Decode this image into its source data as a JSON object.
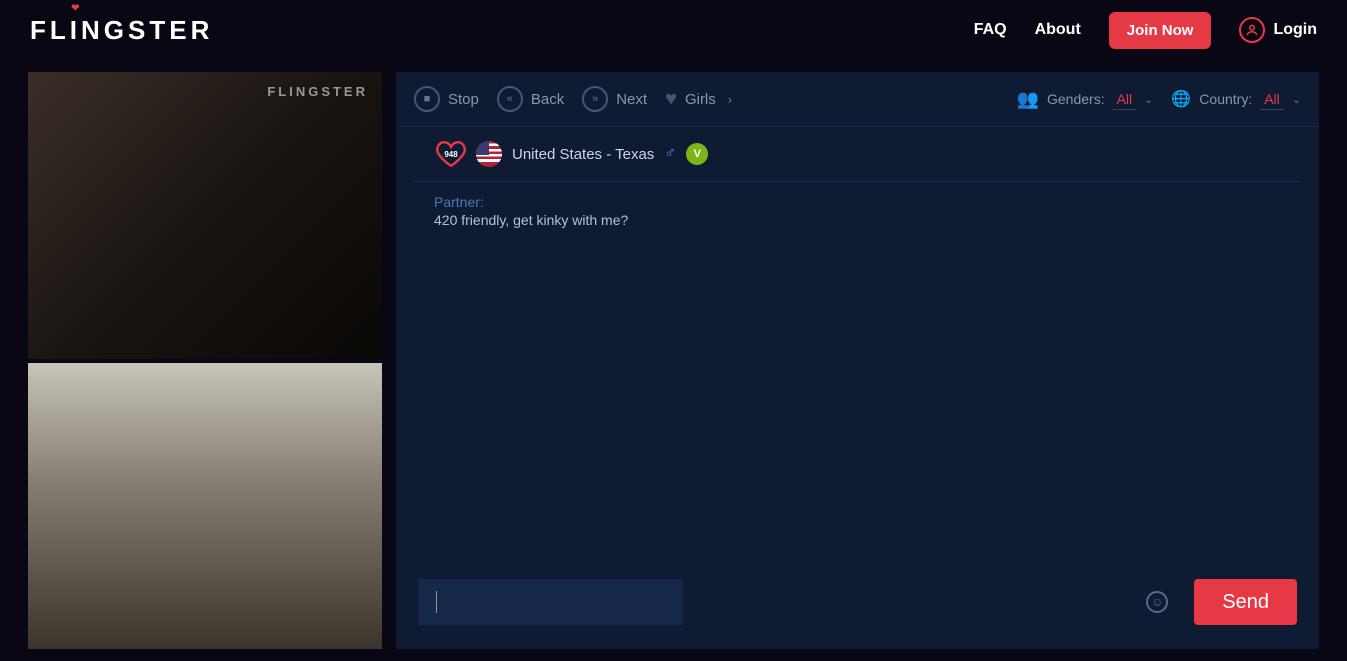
{
  "brand": "FLINGSTER",
  "watermark": "FLINGSTER",
  "nav": {
    "faq": "FAQ",
    "about": "About",
    "join": "Join Now",
    "login": "Login"
  },
  "toolbar": {
    "stop": "Stop",
    "back": "Back",
    "next": "Next",
    "girls": "Girls",
    "genders_label": "Genders:",
    "genders_value": "All",
    "country_label": "Country:",
    "country_value": "All"
  },
  "partner": {
    "likes": "948",
    "location": "United States - Texas",
    "verified_letter": "V"
  },
  "messages": {
    "label": "Partner:",
    "text": "420 friendly, get kinky with me?"
  },
  "input": {
    "placeholder": "",
    "send": "Send"
  }
}
